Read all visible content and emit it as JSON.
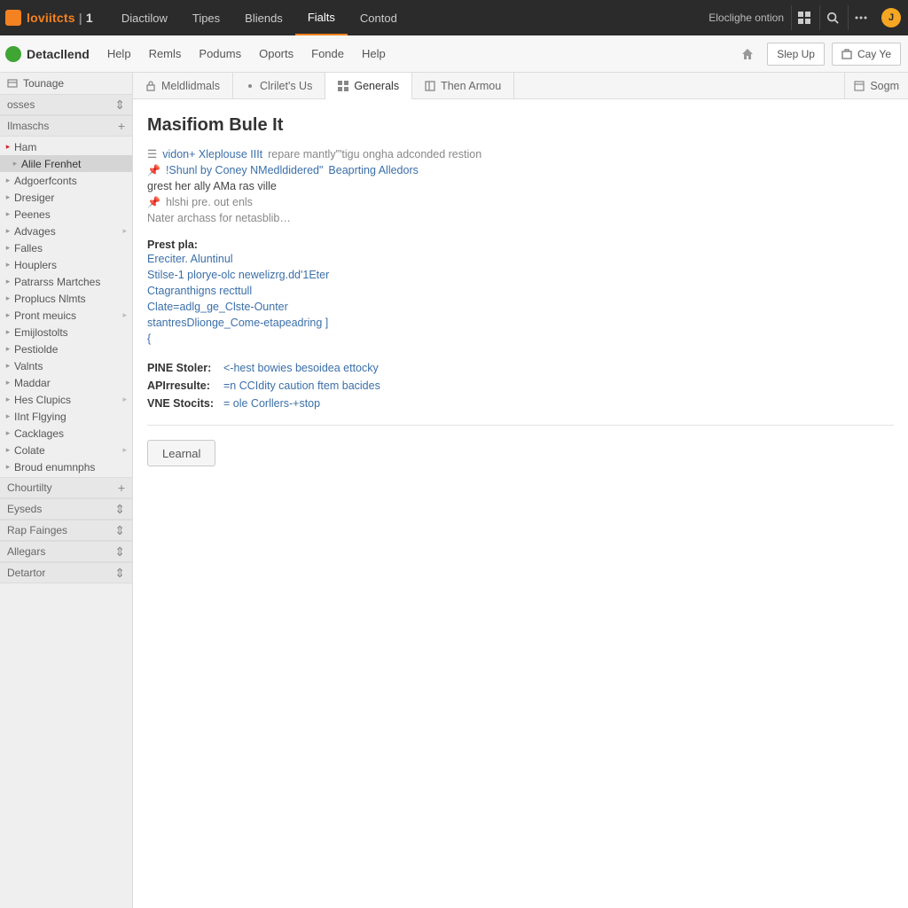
{
  "topbar": {
    "brand": "loviitcts",
    "brand_num": "1",
    "tabs": [
      {
        "label": "Diactilow",
        "active": false
      },
      {
        "label": "Tipes",
        "active": false
      },
      {
        "label": "Bliends",
        "active": false
      },
      {
        "label": "Fialts",
        "active": true
      },
      {
        "label": "Contod",
        "active": false
      }
    ],
    "right_label": "Eloclighe ontion",
    "avatar_initial": "J"
  },
  "menubar": {
    "app": "Detacllend",
    "items": [
      "Help",
      "Remls",
      "Podums",
      "Oports",
      "Fonde",
      "Help"
    ],
    "btn_primary": "Slep Up",
    "btn_secondary": "Cay Ye"
  },
  "sidebar": {
    "section_top": "Tounage",
    "section_osses": "osses",
    "section_imaschs": "Ilmaschs",
    "tree": [
      {
        "label": "Ham",
        "red": true
      },
      {
        "label": "Alile Frenhet",
        "selected": true,
        "sub": true
      },
      {
        "label": "Adgoerfconts"
      },
      {
        "label": "Dresiger"
      },
      {
        "label": "Peenes"
      },
      {
        "label": "Advages",
        "expand": true
      },
      {
        "label": "Falles"
      },
      {
        "label": "Houplers"
      },
      {
        "label": "Patrarss Martches"
      },
      {
        "label": "Proplucs Nlmts"
      },
      {
        "label": "Pront meuics",
        "expand": true
      },
      {
        "label": "Emijlostolts"
      },
      {
        "label": "Pestiolde"
      },
      {
        "label": "Valnts"
      },
      {
        "label": "Maddar"
      },
      {
        "label": "Hes Clupics",
        "expand": true
      },
      {
        "label": "IInt Flgying"
      },
      {
        "label": "Cacklages"
      },
      {
        "label": "Colate",
        "expand": true
      },
      {
        "label": "Broud enumnphs"
      }
    ],
    "sections_bottom": [
      "Chourtilty",
      "Eyseds",
      "Rap Fainges",
      "Allegars",
      "Detartor"
    ]
  },
  "doc_tabs": {
    "items": [
      {
        "label": "Meldlidmals",
        "icon": "lock"
      },
      {
        "label": "Clrilet's Us",
        "icon": "dot"
      },
      {
        "label": "Generals",
        "icon": "grid",
        "active": true
      },
      {
        "label": "Then Armou",
        "icon": "panel"
      }
    ],
    "tail": "Sogm"
  },
  "content": {
    "title": "Masifiom Bule It",
    "summary": [
      {
        "prefix_icon": "menu",
        "link": "vidon+ Xleplouse IIIt",
        "after": "repare mantly\"'tigu ongha adconded restion"
      },
      {
        "prefix_icon": "pin",
        "link": "!Shunl by Coney NMedldidered\"",
        "after": "Beaprting Alledors",
        "after_link": true
      },
      {
        "plain": "grest her ally AMa ras ville"
      },
      {
        "prefix_icon": "pin",
        "plain": "hlshi pre. out enls",
        "muted": true
      },
      {
        "plain": "Nater archass for netasblib…",
        "muted": true
      }
    ],
    "prest_label": "Prest pla:",
    "prest_links": [
      "Ereciter. Aluntinul",
      "Stilse-1 plorye-olc newelizrg.dd'1Eter",
      "Ctagranthigns recttull",
      "Clate=adlg_ge_Clste-Ounter",
      "stantresDlionge_Come-etapeadring ]",
      "{"
    ],
    "kv": [
      {
        "k": "PINE Stoler:",
        "v": "<-hest bowies besoidea ettocky"
      },
      {
        "k": "APIrresulte:",
        "v": "=n CCIdity caution ftem bacides"
      },
      {
        "k": "VNE Stocits:",
        "v": "= ole Corllers-+stop"
      }
    ],
    "button": "Learnal"
  }
}
